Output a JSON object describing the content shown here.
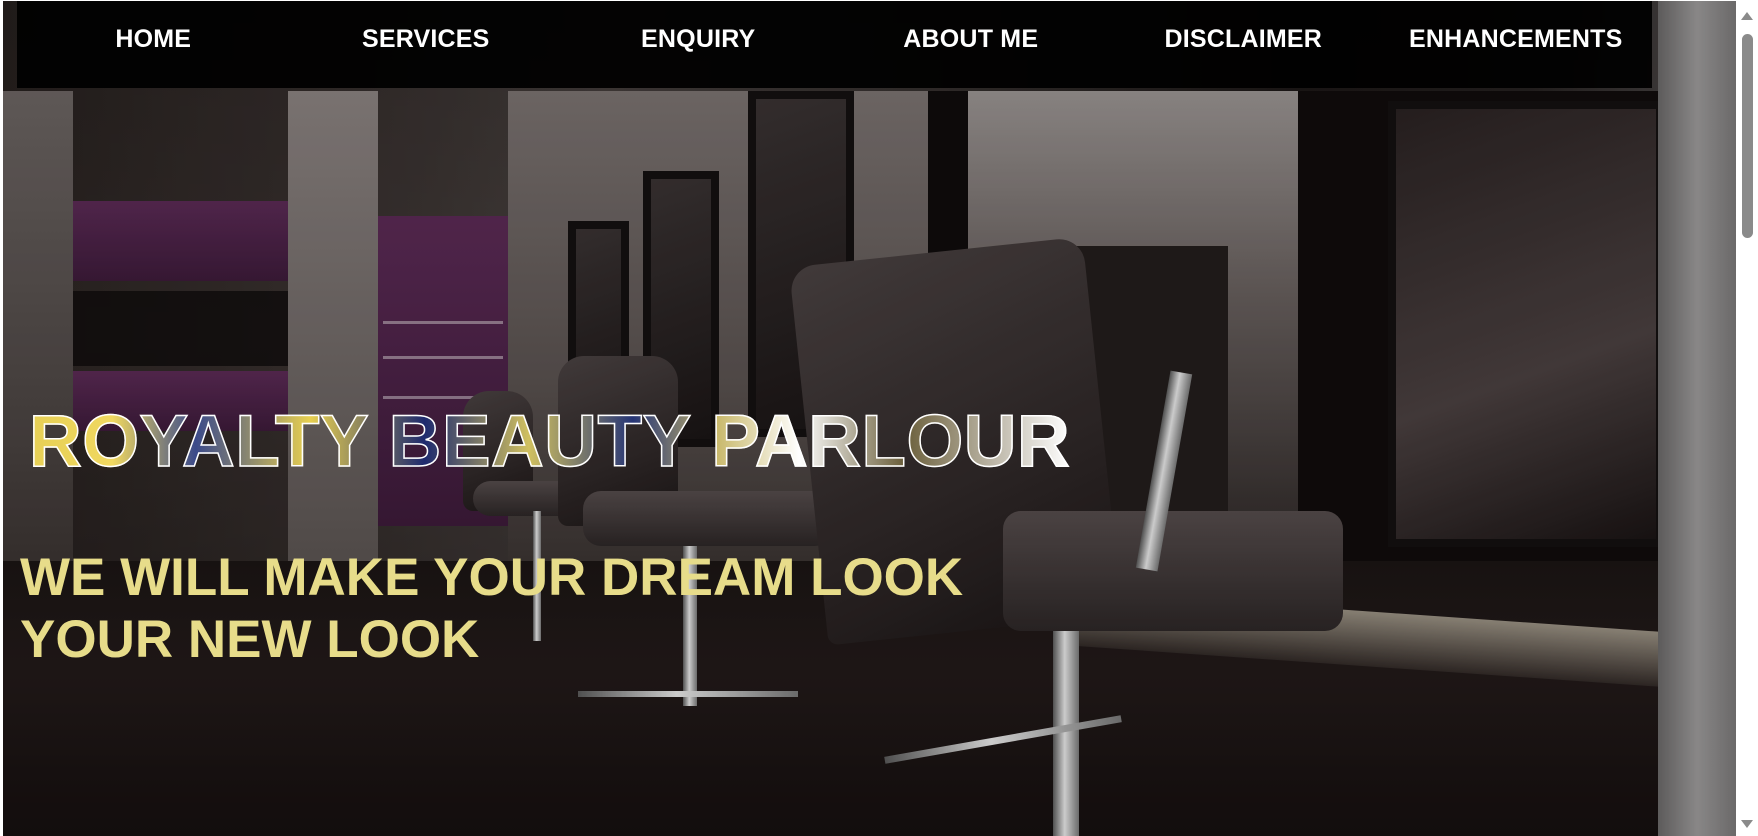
{
  "nav": {
    "items": [
      {
        "label": "HOME"
      },
      {
        "label": "SERVICES"
      },
      {
        "label": "ENQUIRY"
      },
      {
        "label": "ABOUT ME"
      },
      {
        "label": "DISCLAIMER"
      },
      {
        "label": "ENHANCEMENTS"
      }
    ]
  },
  "hero": {
    "title": "ROYALTY BEAUTY PARLOUR",
    "tagline": "WE WILL MAKE YOUR DREAM LOOK YOUR NEW LOOK",
    "background_description_icon": "salon-interior-photo"
  },
  "colors": {
    "nav_background": "#000000",
    "nav_text": "#ffffff",
    "tagline": "#e7dc8a",
    "title_gold": "#e6cf55",
    "title_navy": "#1e2a6e",
    "scrollbar_thumb": "#8a8a8a"
  }
}
